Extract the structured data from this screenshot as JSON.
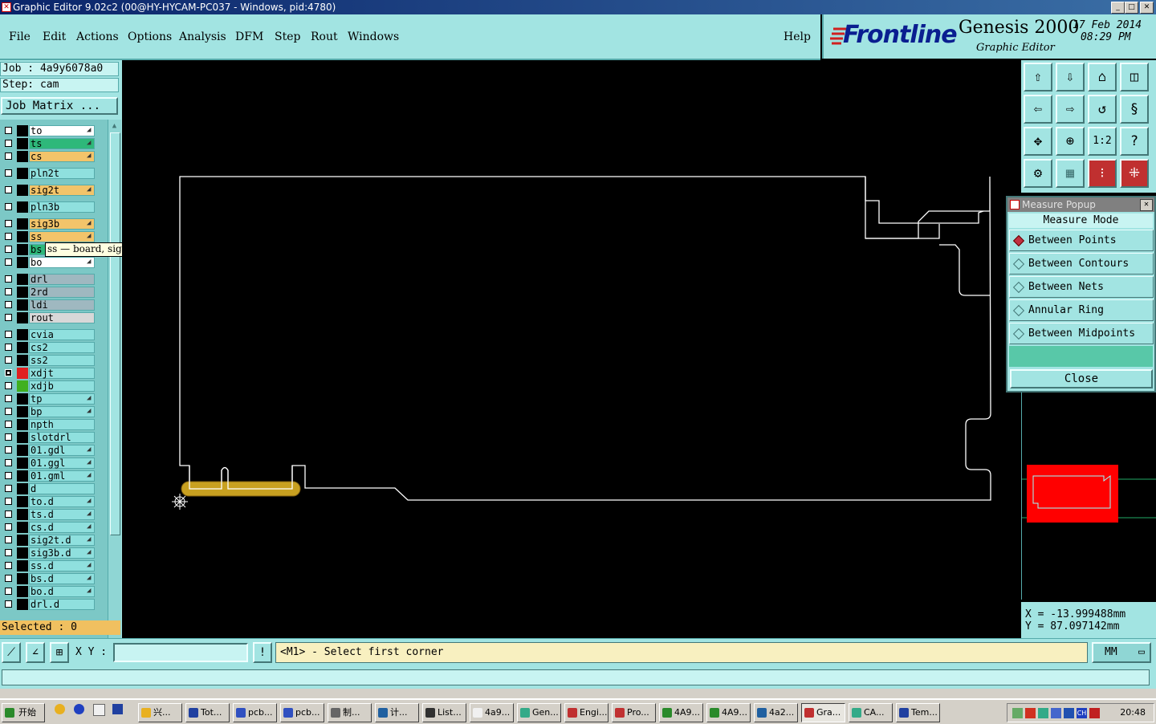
{
  "window": {
    "title": "Graphic Editor 9.02c2 (00@HY-HYCAM-PC037 - Windows, pid:4780)",
    "min": "_",
    "max": "□",
    "close": "✕"
  },
  "menu": {
    "items": [
      "File",
      "Edit",
      "Actions",
      "Options",
      "Analysis",
      "DFM",
      "Step",
      "Rout",
      "Windows"
    ],
    "help": "Help"
  },
  "brand": {
    "logo": "Frontline",
    "product": "Genesis 2000",
    "subtitle": "Graphic Editor",
    "date": "17 Feb 2014",
    "time": "08:29 PM"
  },
  "job": {
    "job": "Job : 4a9y6078a0",
    "step": "Step: cam",
    "matrix_button": "Job Matrix ..."
  },
  "layers": [
    {
      "name": "to",
      "color": "#ffffff",
      "arrow": true
    },
    {
      "name": "ts",
      "color": "#2eb87a",
      "arrow": true
    },
    {
      "name": "cs",
      "color": "#f3c46a",
      "arrow": true
    },
    {
      "name": "pln2t",
      "color": "#8fe0de",
      "arrow": false
    },
    {
      "name": "sig2t",
      "color": "#f3c46a",
      "arrow": true
    },
    {
      "name": "pln3b",
      "color": "#8fe0de",
      "arrow": false
    },
    {
      "name": "sig3b",
      "color": "#f3c46a",
      "arrow": true
    },
    {
      "name": "ss",
      "color": "#f3c46a",
      "arrow": true
    },
    {
      "name": "bs",
      "color": "#2eb87a",
      "arrow": true
    },
    {
      "name": "bo",
      "color": "#ffffff",
      "arrow": true
    },
    {
      "name": "drl",
      "color": "#9fb8c0",
      "arrow": false
    },
    {
      "name": "2rd",
      "color": "#9fb8c0",
      "arrow": false
    },
    {
      "name": "ldi",
      "color": "#9fb8c0",
      "arrow": false
    },
    {
      "name": "rout",
      "color": "#d8d8d8",
      "arrow": false
    },
    {
      "name": "cvia",
      "color": "#8fe0de",
      "arrow": false
    },
    {
      "name": "cs2",
      "color": "#8fe0de",
      "arrow": false
    },
    {
      "name": "ss2",
      "color": "#8fe0de",
      "arrow": false
    },
    {
      "name": "xdjt",
      "color": "#8fe0de",
      "arrow": false
    },
    {
      "name": "xdjb",
      "color": "#8fe0de",
      "arrow": false
    },
    {
      "name": "tp",
      "color": "#8fe0de",
      "arrow": true
    },
    {
      "name": "bp",
      "color": "#8fe0de",
      "arrow": true
    },
    {
      "name": "npth",
      "color": "#8fe0de",
      "arrow": false
    },
    {
      "name": "slotdrl",
      "color": "#8fe0de",
      "arrow": false
    },
    {
      "name": "01.gdl",
      "color": "#8fe0de",
      "arrow": true
    },
    {
      "name": "01.ggl",
      "color": "#8fe0de",
      "arrow": true
    },
    {
      "name": "01.gml",
      "color": "#8fe0de",
      "arrow": true
    },
    {
      "name": "d",
      "color": "#8fe0de",
      "arrow": false
    },
    {
      "name": "to.d",
      "color": "#8fe0de",
      "arrow": true
    },
    {
      "name": "ts.d",
      "color": "#8fe0de",
      "arrow": true
    },
    {
      "name": "cs.d",
      "color": "#8fe0de",
      "arrow": true
    },
    {
      "name": "sig2t.d",
      "color": "#8fe0de",
      "arrow": true
    },
    {
      "name": "sig3b.d",
      "color": "#8fe0de",
      "arrow": true
    },
    {
      "name": "ss.d",
      "color": "#8fe0de",
      "arrow": true
    },
    {
      "name": "bs.d",
      "color": "#8fe0de",
      "arrow": true
    },
    {
      "name": "bo.d",
      "color": "#8fe0de",
      "arrow": true
    },
    {
      "name": "drl.d",
      "color": "#8fe0de",
      "arrow": false
    }
  ],
  "tooltip": "ss — board, signal, positive",
  "selected": "Selected : 0",
  "measure": {
    "title": "Measure Popup",
    "mode_label": "Measure Mode",
    "options": [
      "Between Points",
      "Between Contours",
      "Between Nets",
      "Annular Ring",
      "Between Midpoints"
    ],
    "selected_option": "Between Points",
    "close": "Close"
  },
  "coords": {
    "x": "X = -13.999488mm",
    "y": "Y = 87.097142mm"
  },
  "bottom": {
    "xy_label": "X Y :",
    "xy_value": "",
    "bang": "!",
    "prompt": "<M1> - Select first corner",
    "units": "MM"
  },
  "taskbar": {
    "start": "开始",
    "tasks": [
      "兴...",
      "Tot...",
      "pcb...",
      "pcb...",
      "制...",
      "计...",
      "List...",
      "4a9...",
      "Gen...",
      "Engi...",
      "Pro...",
      "4A9...",
      "4A9...",
      "4a2...",
      "Gra...",
      "CA...",
      "Tem..."
    ],
    "active": "Gra...",
    "clock": "20:48"
  },
  "colors": {
    "panel": "#a2e4e2",
    "board_outline": "#ffffff",
    "gold": "#c8a020",
    "overview_red": "#ff0000"
  }
}
